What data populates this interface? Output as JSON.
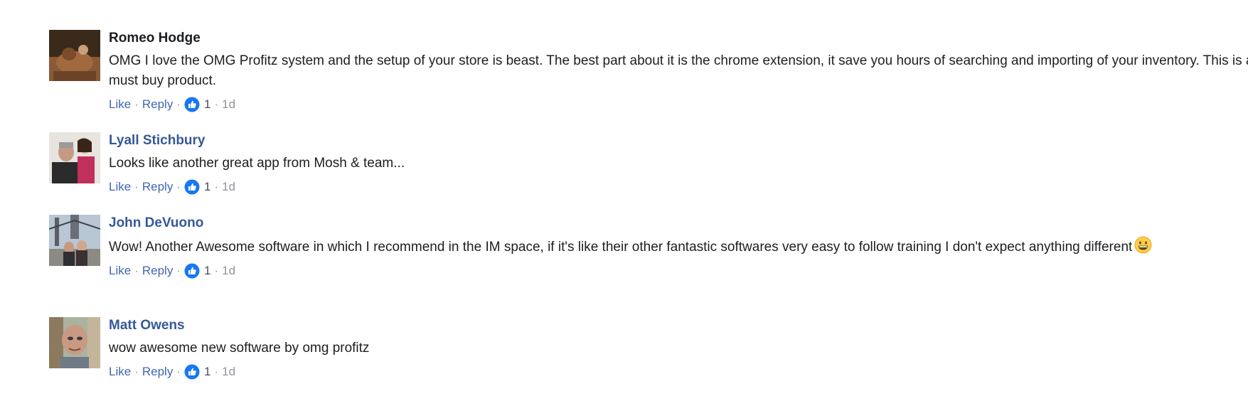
{
  "comments": [
    {
      "author": "Romeo Hodge",
      "text": "OMG I love the OMG Profitz system and the setup of your store is beast. The best part about it is the chrome extension, it save you hours of searching and importing of your inventory. This is a must buy product.",
      "like_label": "Like",
      "reply_label": "Reply",
      "reaction_count": "1",
      "time": "1d",
      "avatar": "man-with-dog-photo"
    },
    {
      "author": "Lyall Stichbury",
      "text": "Looks like another great app from Mosh & team...",
      "like_label": "Like",
      "reply_label": "Reply",
      "reaction_count": "1",
      "time": "1d",
      "avatar": "man-with-child-photo"
    },
    {
      "author": "John DeVuono",
      "text": "Wow! Another Awesome software in which I recommend in the IM space, if it's like their other fantastic softwares very easy to follow training I don't expect anything different",
      "emoji": "grinning-face",
      "like_label": "Like",
      "reply_label": "Reply",
      "reaction_count": "1",
      "time": "1d",
      "avatar": "couple-on-bridge-photo"
    },
    {
      "author": "Matt Owens",
      "text": "wow awesome new software by omg profitz",
      "like_label": "Like",
      "reply_label": "Reply",
      "reaction_count": "1",
      "time": "1d",
      "avatar": "man-portrait-photo"
    }
  ],
  "colors": {
    "link": "#4267b2",
    "author": "#365899",
    "meta": "#90949c",
    "like_icon": "#1877f2"
  }
}
